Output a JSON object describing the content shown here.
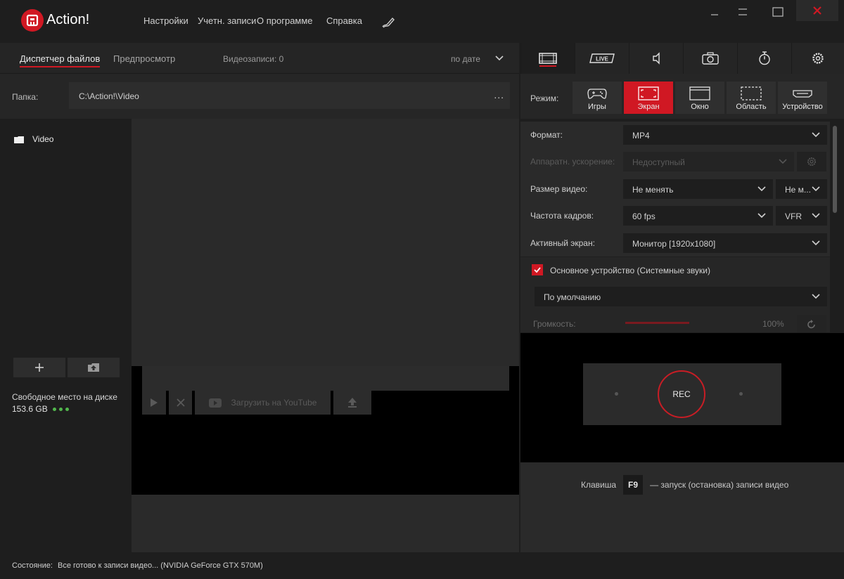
{
  "app": {
    "title": "Action!",
    "brand_color": "#d01823"
  },
  "menu": [
    "Настройки",
    "Учетн. записи",
    "О программе",
    "Справка"
  ],
  "left_tabs": [
    {
      "label": "Диспетчер файлов",
      "active": true
    },
    {
      "label": "Предпросмотр",
      "active": false
    }
  ],
  "video_count": "Видеозаписи: 0",
  "sort": {
    "label": "по дате"
  },
  "folder": {
    "label": "Папка:",
    "path": "C:\\Action!\\Video",
    "more": "..."
  },
  "tree": {
    "item": "Video"
  },
  "disk": {
    "label": "Свободное место на диске",
    "value": "153.6 GB"
  },
  "player": {
    "upload_label": "Загрузить на YouTube"
  },
  "right_tabs": [
    "video-tab",
    "live-tab",
    "audio-tab",
    "screenshot-tab",
    "timer-tab",
    "settings-tab"
  ],
  "mode": {
    "label": "Режим:",
    "options": [
      {
        "label": "Игры",
        "active": false
      },
      {
        "label": "Экран",
        "active": true
      },
      {
        "label": "Окно",
        "active": false
      },
      {
        "label": "Область",
        "active": false
      },
      {
        "label": "Устройство",
        "active": false
      }
    ]
  },
  "settings": {
    "format": {
      "label": "Формат:",
      "value": "MP4"
    },
    "hw_accel": {
      "label": "Аппаратн. ускорение:",
      "value": "Недоступный"
    },
    "video_size": {
      "label": "Размер видео:",
      "value": "Не менять",
      "value2": "Не м..."
    },
    "framerate": {
      "label": "Частота кадров:",
      "value": "60 fps",
      "value2": "VFR"
    },
    "active_screen": {
      "label": "Активный экран:",
      "value": "Монитор [1920x1080]"
    },
    "audio_device": {
      "label": "Основное устройство (Системные звуки)",
      "checked": true,
      "value": "По умолчанию"
    },
    "volume": {
      "label": "Громкость:",
      "value": "100%",
      "level": 1.0
    }
  },
  "rec": {
    "label": "REC"
  },
  "hotkey": {
    "prefix": "Клавиша",
    "key": "F9",
    "suffix": "— запуск (остановка) записи видео"
  },
  "status": {
    "label": "Состояние:",
    "text": "Все готово к записи видео... (NVIDIA GeForce GTX 570M)"
  }
}
